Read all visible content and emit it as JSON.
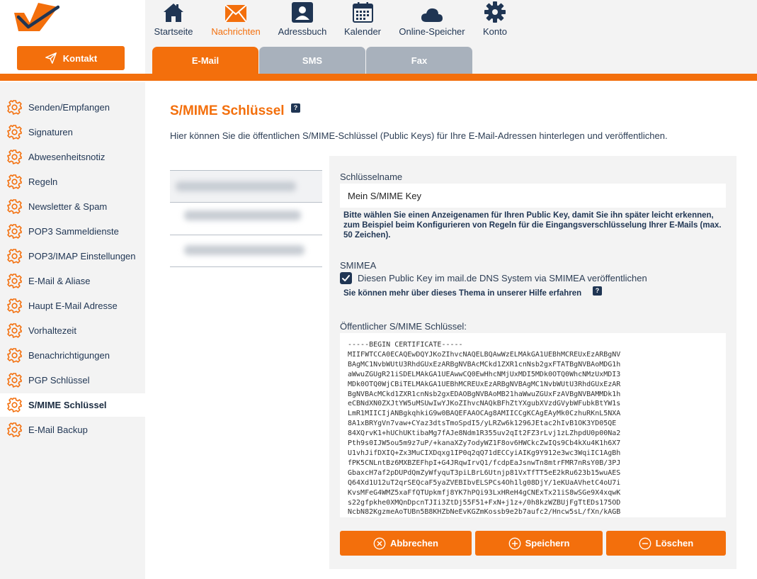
{
  "header": {
    "kontakt_label": "Kontakt",
    "nav": [
      {
        "label": "Startseite",
        "icon": "home-icon"
      },
      {
        "label": "Nachrichten",
        "icon": "envelope-icon"
      },
      {
        "label": "Adressbuch",
        "icon": "contact-book-icon"
      },
      {
        "label": "Kalender",
        "icon": "calendar-icon"
      },
      {
        "label": "Online-Speicher",
        "icon": "cloud-icon"
      },
      {
        "label": "Konto",
        "icon": "gear-icon"
      }
    ],
    "active_nav": "Nachrichten",
    "tabs": [
      {
        "label": "E-Mail",
        "active": true
      },
      {
        "label": "SMS",
        "active": false
      },
      {
        "label": "Fax",
        "active": false
      }
    ]
  },
  "sidebar": {
    "items": [
      {
        "label": "Senden/Empfangen"
      },
      {
        "label": "Signaturen"
      },
      {
        "label": "Abwesenheitsnotiz"
      },
      {
        "label": "Regeln"
      },
      {
        "label": "Newsletter & Spam"
      },
      {
        "label": "POP3 Sammeldienste"
      },
      {
        "label": "POP3/IMAP Einstellungen"
      },
      {
        "label": "E-Mail & Aliase"
      },
      {
        "label": "Haupt E-Mail Adresse"
      },
      {
        "label": "Vorhaltezeit"
      },
      {
        "label": "Benachrichtigungen"
      },
      {
        "label": "PGP Schlüssel"
      },
      {
        "label": "S/MIME Schlüssel"
      },
      {
        "label": "E-Mail Backup"
      }
    ],
    "active_item": "S/MIME Schlüssel"
  },
  "main": {
    "title": "S/MIME Schlüssel",
    "help_badge": "?",
    "intro": "Hier können Sie die öffentlichen S/MIME-Schlüssel (Public Keys) für Ihre E-Mail-Adressen hinterlegen und veröffentlichen.",
    "form": {
      "name_label": "Schlüsselname",
      "name_value": "Mein S/MIME Key",
      "name_hint": "Bitte wählen Sie einen Anzeigenamen für Ihren Public Key, damit Sie ihn später leicht erkennen, zum Beispiel beim Konfigurieren von Regeln für die Eingangsverschlüsselung Ihrer E-Mails (max. 50 Zeichen).",
      "smimea_label": "SMIMEA",
      "smimea_checkbox_label": "Diesen Public Key im mail.de DNS System via SMIMEA veröffentlichen",
      "smimea_checked": true,
      "help_link": "Sie können mehr über dieses Thema in unserer Hilfe erfahren",
      "cert_label": "Öffentlicher S/MIME Schlüssel:",
      "cert_value": "-----BEGIN CERTIFICATE-----\nMIIFWTCCA0ECAQEwDQYJKoZIhvcNAQELBQAwWzELMAkGA1UEBhMCREUxEzARBgNV\nBAgMC1NvbWUtU3RhdGUxEzARBgNVBAcMCkd1ZXR1cnNsb2gxFTATBgNVBAoMDG1h\naWwuZGUgR21iSDELMAkGA1UEAwwCQ0EwHhcNMjUxMDI5MDk0OTQ0WhcNMzUxMDI3\nMDk0OTQ0WjCBiTELMAkGA1UEBhMCREUxEzARBgNVBAgMC1NvbWUtU3RhdGUxEzAR\nBgNVBAcMCkd1ZXR1cnNsb2gxEDAOBgNVBAoMB21haWwuZGUxFzAVBgNVBAMMDk1h\neCBNdXN0ZXJtYW5uMSUwIwYJKoZIhvcNAQkBFhZtYXgubXVzdGVybWFubkBtYW1s\nLmR1MIICIjANBgkqhkiG9w0BAQEFAAOCAg8AMIICCgKCAgEAyMk0CzhuRKnL5NXA\n8A1xBRYgVn7vaw+CYaz3dtsTmoSpdI5/yLRZw6k1296JEtac2hIvB1OK3YD05QE\n84XQrvK1+hUChUKtibaMg7fAJe8Ndm1R355uv2qIt2FZ3rLvj1zLZhpdU0p00Na2\nPth9s0IJW5ou5m9z7uP/+kanaXZy7odyWZ1F8ov6HWCkcZwIQs9Cb4kXu4K1h6X7\nU1vhJifDXIQ+Zx3MuCIXDqxg1IP0q2qQ71dECCyiAIKg9Y912e3wc3WqiIC1AgBh\nfPK5CNLntBz6MXBZEFhpI+G4JRqwIrvQ1/fcdpEaJsnwTn8mtrFMR7nRsY0B/3PJ\nGbaxcH7af2pDUPdQmZyWfyquT3piLBrL6Utnjp81VxTfTT5eE2kRu623b15wuAES\nQ64Xd1U12uT2qrSEQcaF5yaZVEBIbvELSPCs4Oh1lg08DjY/1eKUaAVhetC4oU7i\nKvsMFeG4WMZ5xaFfQTUpkmfj8YK7hPQi93LxHReH4gCNExTx21iS8wSGe9X4xqwK\ns22gfpkhe0XMQnDpcnTJIi3ZtDj55F51+FxN+j1z+/0h8kzWZBUjFgTtEDs175OD\nNcbN82KgzmeAoTUBn5B8KHZbNeEvKGZmKossb9e2b7aufc2/Hncw5sL/fXn/kAGB",
      "buttons": {
        "cancel": "Abbrechen",
        "save": "Speichern",
        "delete": "Löschen"
      }
    }
  },
  "colors": {
    "accent": "#f36f0c",
    "navy": "#1f3553",
    "tab_inactive": "#a8b1bc",
    "panel": "#f3f3f3"
  }
}
